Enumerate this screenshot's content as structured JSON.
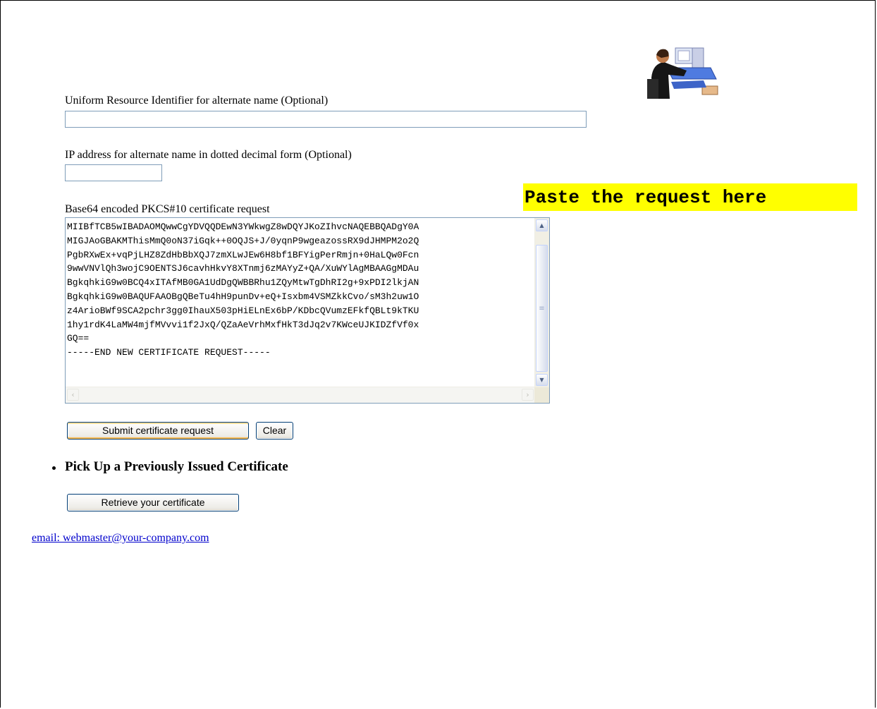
{
  "form": {
    "uri_label": "Uniform Resource Identifier for alternate name (Optional)",
    "uri_value": "",
    "ip_label": "IP address for alternate name in dotted decimal form (Optional)",
    "ip_value": "",
    "request_label": "Base64 encoded PKCS#10 certificate request",
    "request_value": "MIIBfTCB5wIBADAOMQwwCgYDVQQDEwN3YWkwgZ8wDQYJKoZIhvcNAQEBBQADgY0A\nMIGJAoGBAKMThisMmQ0oN37iGqk++0OQJS+J/0yqnP9wgeazossRX9dJHMPM2o2Q\nPgbRXwEx+vqPjLHZ8ZdHbBbXQJ7zmXLwJEw6H8bf1BFYigPerRmjn+0HaLQw0Fcn\n9wwVNVlQh3wojC9OENTSJ6cavhHkvY8XTnmj6zMAYyZ+QA/XuWYlAgMBAAGgMDAu\nBgkqhkiG9w0BCQ4xITAfMB0GA1UdDgQWBBRhu1ZQyMtwTgDhRI2g+9xPDI2lkjAN\nBgkqhkiG9w0BAQUFAAOBgQBeTu4hH9punDv+eQ+Isxbm4VSMZkkCvo/sM3h2uw1O\nz4ArioBWf9SCA2pchr3gg0IhauX503pHiELnEx6bP/KDbcQVumzEFkfQBLt9kTKU\n1hy1rdK4LaMW4mjfMVvvi1f2JxQ/QZaAeVrhMxfHkT3dJq2v7KWceUJKIDZfVf0x\nGQ==\n-----END NEW CERTIFICATE REQUEST-----",
    "submit_label": "Submit certificate request",
    "clear_label": "Clear"
  },
  "callout": {
    "text": "Paste the request here",
    "color": "#ffff00"
  },
  "pickup": {
    "title": "Pick Up a Previously Issued Certificate",
    "retrieve_label": "Retrieve your certificate"
  },
  "footer": {
    "email_text": "email: webmaster@your-company.com",
    "link_color": "#0000cc"
  },
  "icons": {
    "clipart": "computer-user-icon",
    "scroll_up": "scroll-up-arrow-icon",
    "scroll_down": "scroll-down-arrow-icon",
    "scroll_left": "scroll-left-arrow-icon",
    "scroll_right": "scroll-right-arrow-icon"
  }
}
